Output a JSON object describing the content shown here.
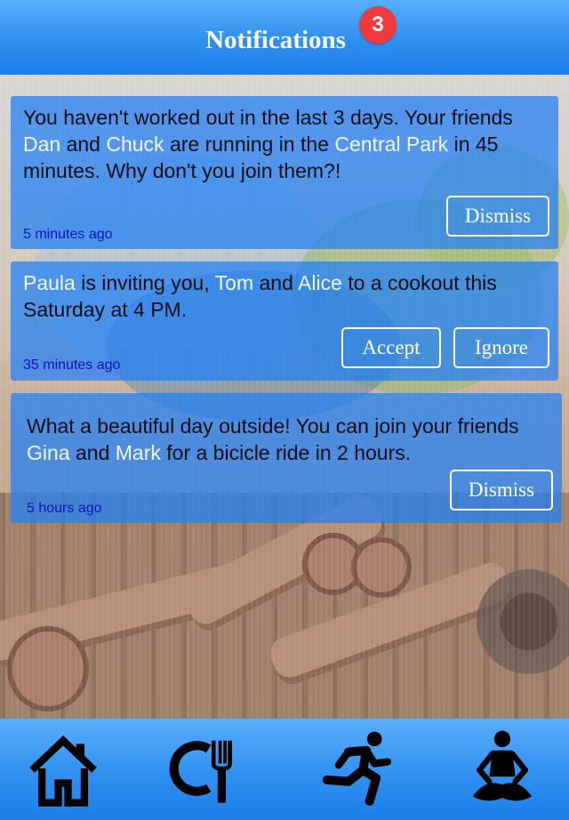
{
  "header": {
    "title": "Notifications",
    "badge_count": "3"
  },
  "notifications": [
    {
      "segments": [
        "You haven't worked out in the last 3 days. Your friends ",
        "Dan",
        " and ",
        "Chuck",
        " are running in the ",
        "Central Park",
        " in 45 minutes. Why don't you join them?!"
      ],
      "time": "5 minutes ago",
      "buttons": {
        "dismiss": "Dismiss"
      }
    },
    {
      "segments": [
        "Paula",
        " is inviting you, ",
        "Tom",
        " and ",
        "Alice",
        " to a cookout this Saturday at 4 PM."
      ],
      "time": "35 minutes ago",
      "buttons": {
        "accept": "Accept",
        "ignore": "Ignore"
      }
    },
    {
      "segments": [
        "What a beautiful day outside! You can join your friends ",
        "Gina",
        " and ",
        "Mark",
        " for a bicicle ride in 2 hours."
      ],
      "time": "5 hours ago",
      "buttons": {
        "dismiss": "Dismiss"
      }
    }
  ],
  "tabbar": {
    "tabs": [
      {
        "icon": "home-icon"
      },
      {
        "icon": "restaurant-icon"
      },
      {
        "icon": "running-icon"
      },
      {
        "icon": "meditation-icon"
      }
    ]
  },
  "colors": {
    "header_blue": "#2f8ff0",
    "card_blue": "#217ff7",
    "badge_red": "#f2393c",
    "highlight_text": "#f2f7ff",
    "timestamp_text": "#1212bb"
  }
}
